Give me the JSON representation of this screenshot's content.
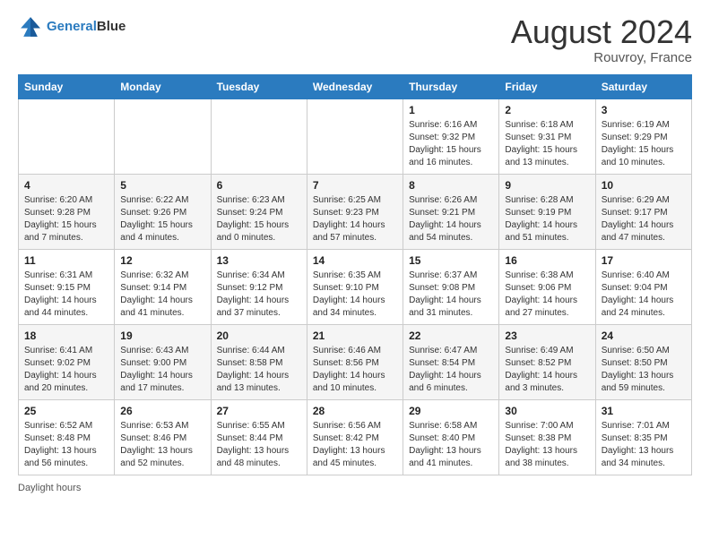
{
  "header": {
    "logo_line1": "General",
    "logo_line2": "Blue",
    "month_title": "August 2024",
    "location": "Rouvroy, France"
  },
  "footer": {
    "daylight_label": "Daylight hours"
  },
  "days_of_week": [
    "Sunday",
    "Monday",
    "Tuesday",
    "Wednesday",
    "Thursday",
    "Friday",
    "Saturday"
  ],
  "weeks": [
    [
      {
        "day": "",
        "info": ""
      },
      {
        "day": "",
        "info": ""
      },
      {
        "day": "",
        "info": ""
      },
      {
        "day": "",
        "info": ""
      },
      {
        "day": "1",
        "info": "Sunrise: 6:16 AM\nSunset: 9:32 PM\nDaylight: 15 hours and 16 minutes."
      },
      {
        "day": "2",
        "info": "Sunrise: 6:18 AM\nSunset: 9:31 PM\nDaylight: 15 hours and 13 minutes."
      },
      {
        "day": "3",
        "info": "Sunrise: 6:19 AM\nSunset: 9:29 PM\nDaylight: 15 hours and 10 minutes."
      }
    ],
    [
      {
        "day": "4",
        "info": "Sunrise: 6:20 AM\nSunset: 9:28 PM\nDaylight: 15 hours and 7 minutes."
      },
      {
        "day": "5",
        "info": "Sunrise: 6:22 AM\nSunset: 9:26 PM\nDaylight: 15 hours and 4 minutes."
      },
      {
        "day": "6",
        "info": "Sunrise: 6:23 AM\nSunset: 9:24 PM\nDaylight: 15 hours and 0 minutes."
      },
      {
        "day": "7",
        "info": "Sunrise: 6:25 AM\nSunset: 9:23 PM\nDaylight: 14 hours and 57 minutes."
      },
      {
        "day": "8",
        "info": "Sunrise: 6:26 AM\nSunset: 9:21 PM\nDaylight: 14 hours and 54 minutes."
      },
      {
        "day": "9",
        "info": "Sunrise: 6:28 AM\nSunset: 9:19 PM\nDaylight: 14 hours and 51 minutes."
      },
      {
        "day": "10",
        "info": "Sunrise: 6:29 AM\nSunset: 9:17 PM\nDaylight: 14 hours and 47 minutes."
      }
    ],
    [
      {
        "day": "11",
        "info": "Sunrise: 6:31 AM\nSunset: 9:15 PM\nDaylight: 14 hours and 44 minutes."
      },
      {
        "day": "12",
        "info": "Sunrise: 6:32 AM\nSunset: 9:14 PM\nDaylight: 14 hours and 41 minutes."
      },
      {
        "day": "13",
        "info": "Sunrise: 6:34 AM\nSunset: 9:12 PM\nDaylight: 14 hours and 37 minutes."
      },
      {
        "day": "14",
        "info": "Sunrise: 6:35 AM\nSunset: 9:10 PM\nDaylight: 14 hours and 34 minutes."
      },
      {
        "day": "15",
        "info": "Sunrise: 6:37 AM\nSunset: 9:08 PM\nDaylight: 14 hours and 31 minutes."
      },
      {
        "day": "16",
        "info": "Sunrise: 6:38 AM\nSunset: 9:06 PM\nDaylight: 14 hours and 27 minutes."
      },
      {
        "day": "17",
        "info": "Sunrise: 6:40 AM\nSunset: 9:04 PM\nDaylight: 14 hours and 24 minutes."
      }
    ],
    [
      {
        "day": "18",
        "info": "Sunrise: 6:41 AM\nSunset: 9:02 PM\nDaylight: 14 hours and 20 minutes."
      },
      {
        "day": "19",
        "info": "Sunrise: 6:43 AM\nSunset: 9:00 PM\nDaylight: 14 hours and 17 minutes."
      },
      {
        "day": "20",
        "info": "Sunrise: 6:44 AM\nSunset: 8:58 PM\nDaylight: 14 hours and 13 minutes."
      },
      {
        "day": "21",
        "info": "Sunrise: 6:46 AM\nSunset: 8:56 PM\nDaylight: 14 hours and 10 minutes."
      },
      {
        "day": "22",
        "info": "Sunrise: 6:47 AM\nSunset: 8:54 PM\nDaylight: 14 hours and 6 minutes."
      },
      {
        "day": "23",
        "info": "Sunrise: 6:49 AM\nSunset: 8:52 PM\nDaylight: 14 hours and 3 minutes."
      },
      {
        "day": "24",
        "info": "Sunrise: 6:50 AM\nSunset: 8:50 PM\nDaylight: 13 hours and 59 minutes."
      }
    ],
    [
      {
        "day": "25",
        "info": "Sunrise: 6:52 AM\nSunset: 8:48 PM\nDaylight: 13 hours and 56 minutes."
      },
      {
        "day": "26",
        "info": "Sunrise: 6:53 AM\nSunset: 8:46 PM\nDaylight: 13 hours and 52 minutes."
      },
      {
        "day": "27",
        "info": "Sunrise: 6:55 AM\nSunset: 8:44 PM\nDaylight: 13 hours and 48 minutes."
      },
      {
        "day": "28",
        "info": "Sunrise: 6:56 AM\nSunset: 8:42 PM\nDaylight: 13 hours and 45 minutes."
      },
      {
        "day": "29",
        "info": "Sunrise: 6:58 AM\nSunset: 8:40 PM\nDaylight: 13 hours and 41 minutes."
      },
      {
        "day": "30",
        "info": "Sunrise: 7:00 AM\nSunset: 8:38 PM\nDaylight: 13 hours and 38 minutes."
      },
      {
        "day": "31",
        "info": "Sunrise: 7:01 AM\nSunset: 8:35 PM\nDaylight: 13 hours and 34 minutes."
      }
    ]
  ]
}
